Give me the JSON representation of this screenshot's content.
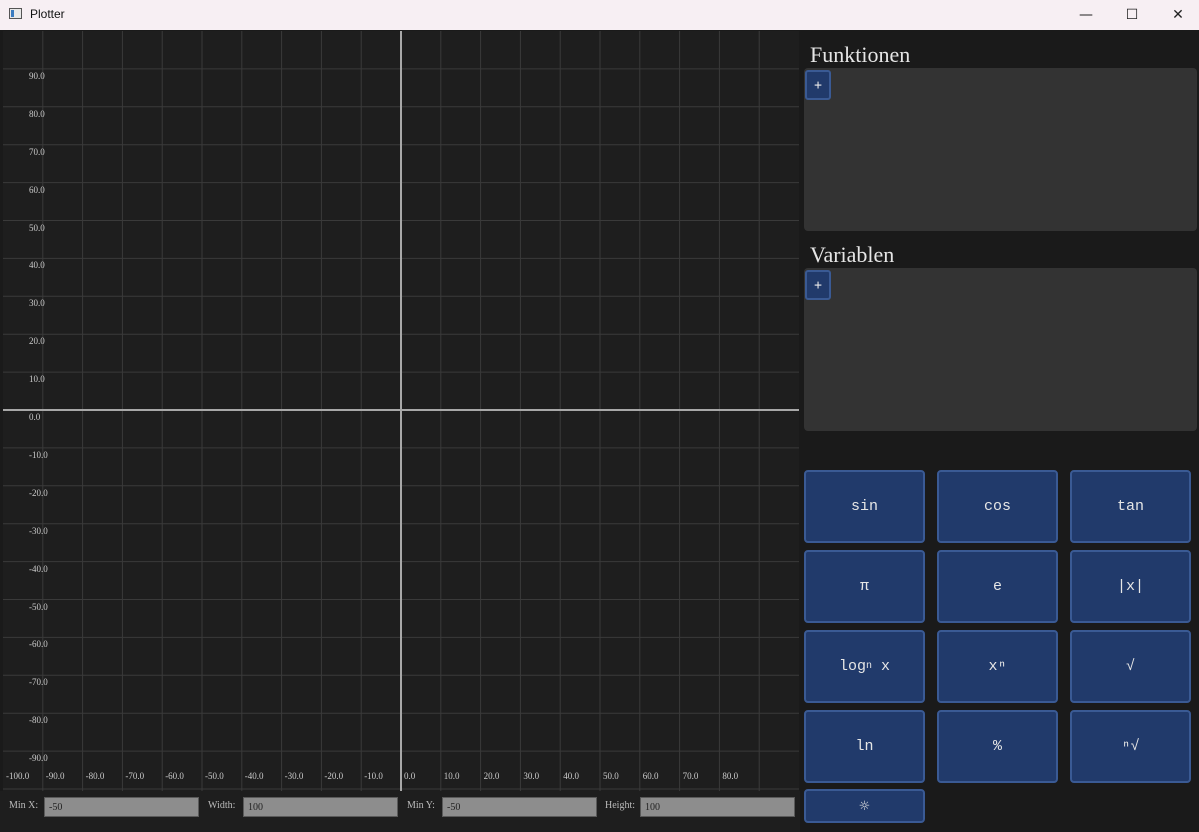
{
  "window": {
    "title": "Plotter",
    "minimize_glyph": "—",
    "maximize_glyph": "☐",
    "close_glyph": "✕"
  },
  "plot": {
    "y_ticks": [
      "90.0",
      "80.0",
      "70.0",
      "60.0",
      "50.0",
      "40.0",
      "30.0",
      "20.0",
      "10.0",
      "0.0",
      "-10.0",
      "-20.0",
      "-30.0",
      "-40.0",
      "-50.0",
      "-60.0",
      "-70.0",
      "-80.0",
      "-90.0"
    ],
    "x_ticks": [
      "-100.0",
      "-90.0",
      "-80.0",
      "-70.0",
      "-60.0",
      "-50.0",
      "-40.0",
      "-30.0",
      "-20.0",
      "-10.0",
      "0.0",
      "10.0",
      "20.0",
      "30.0",
      "40.0",
      "50.0",
      "60.0",
      "70.0",
      "80.0"
    ],
    "colors": {
      "background": "#1e1e1e",
      "grid": "#3a3a3a",
      "axis": "#a8a8a8"
    }
  },
  "controls": {
    "min_x": {
      "label": "Min X:",
      "value": "-50"
    },
    "width": {
      "label": "Width:",
      "value": "100"
    },
    "min_y": {
      "label": "Min Y:",
      "value": "-50"
    },
    "height": {
      "label": "Height:",
      "value": "100"
    }
  },
  "functions": {
    "title": "Funktionen",
    "add_label": "+"
  },
  "variables": {
    "title": "Variablen",
    "add_label": "+"
  },
  "keypad": {
    "sin": "sin",
    "cos": "cos",
    "tan": "tan",
    "pi": "π",
    "e": "e",
    "abs": "|x|",
    "log_main": "log",
    "log_sub": "n",
    "log_arg": " x",
    "power": "xⁿ",
    "sqrt": "√",
    "ln": "ln",
    "percent": "%",
    "nroot": "ⁿ√",
    "theme": "☼"
  },
  "accent_colors": {
    "button_fill": "#213a6b",
    "button_border": "#3a5a94"
  }
}
